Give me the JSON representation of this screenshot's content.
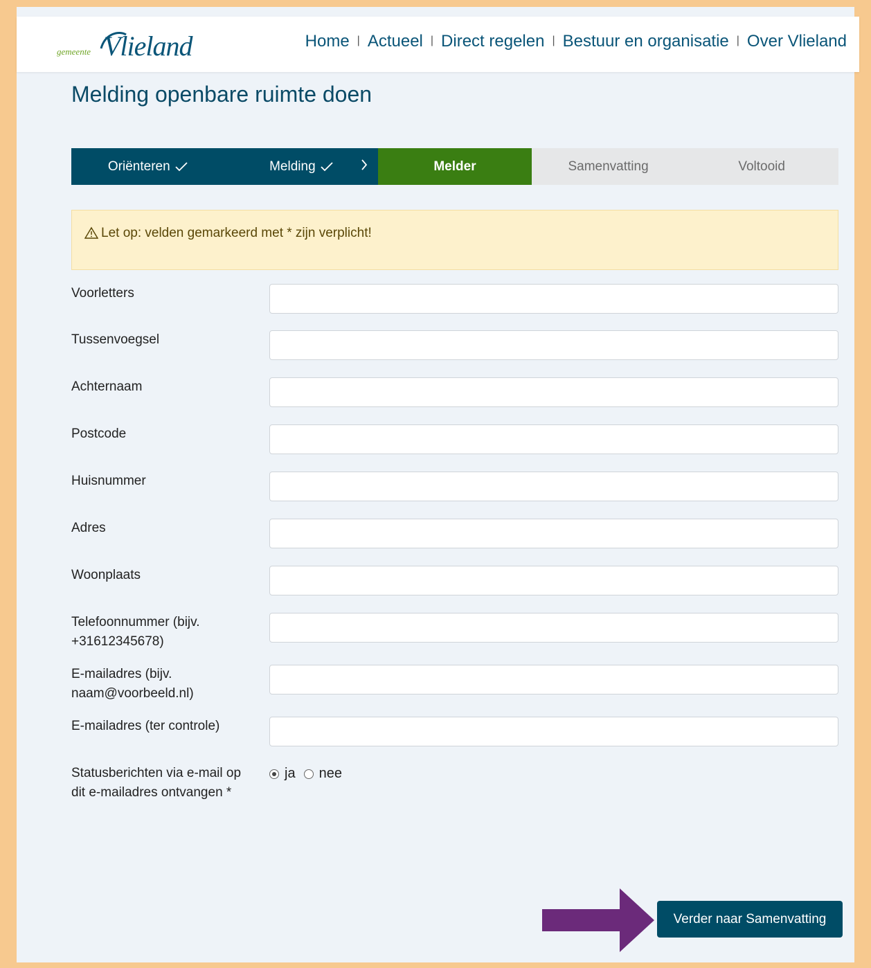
{
  "header": {
    "logo_small": "gemeente",
    "logo_main": "Vlieland",
    "nav": [
      {
        "label": "Home"
      },
      {
        "label": "Actueel"
      },
      {
        "label": "Direct regelen"
      },
      {
        "label": "Bestuur en organisatie"
      },
      {
        "label": "Over Vlieland"
      }
    ]
  },
  "page": {
    "title": "Melding openbare ruimte doen"
  },
  "steps": [
    {
      "label": "Oriënteren",
      "state": "done"
    },
    {
      "label": "Melding",
      "state": "done"
    },
    {
      "label": "Melder",
      "state": "active"
    },
    {
      "label": "Samenvatting",
      "state": "todo"
    },
    {
      "label": "Voltooid",
      "state": "todo"
    }
  ],
  "alert": {
    "text": "Let op: velden gemarkeerd met * zijn verplicht!"
  },
  "form": {
    "fields": [
      {
        "label": "Voorletters",
        "value": ""
      },
      {
        "label": "Tussenvoegsel",
        "value": ""
      },
      {
        "label": "Achternaam",
        "value": ""
      },
      {
        "label": "Postcode",
        "value": ""
      },
      {
        "label": "Huisnummer",
        "value": ""
      },
      {
        "label": "Adres",
        "value": ""
      },
      {
        "label": "Woonplaats",
        "value": ""
      },
      {
        "label": "Telefoonnummer (bijv. +31612345678)",
        "value": ""
      },
      {
        "label": "E-mailadres (bijv. naam@voorbeeld.nl)",
        "value": ""
      },
      {
        "label": "E-mailadres (ter controle)",
        "value": ""
      }
    ],
    "status_question": {
      "label": "Statusberichten via e-mail op dit e-mailadres ontvangen *",
      "options": [
        {
          "label": "ja",
          "selected": true
        },
        {
          "label": "nee",
          "selected": false
        }
      ]
    },
    "next_button": "Verder naar Samenvatting"
  },
  "colors": {
    "brand_dark": "#004c66",
    "active_step": "#3a7e12",
    "annotation_arrow": "#6b2a7a",
    "page_border": "#f7c98f"
  }
}
